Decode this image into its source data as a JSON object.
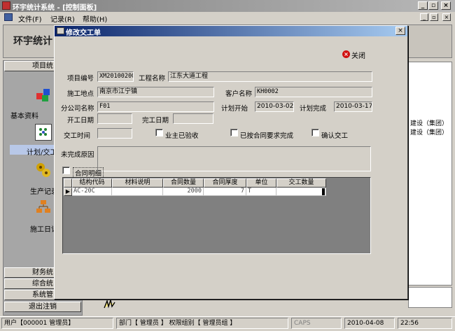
{
  "app": {
    "title": "环宇统计系统 - [控制面板]"
  },
  "menu": {
    "items": [
      "文件(F)",
      "记录(R)",
      "帮助(H)"
    ]
  },
  "backdrop": {
    "header_title": "环宇统计",
    "side_head": "项目统",
    "side_items": [
      "基本资料",
      "计划/交工",
      "生产记录",
      "施工日记"
    ],
    "side_bottom": [
      "财务统",
      "综合统",
      "系统管",
      "退出注销"
    ],
    "right_rows": [
      "建设（集团）",
      "建设（集团）"
    ]
  },
  "dialog": {
    "title": "修改交工单",
    "close_label": "关闭",
    "labels": {
      "project_no": "项目编号",
      "project_name": "工程名称",
      "site": "施工地点",
      "customer": "客户名称",
      "branch": "分公司名称",
      "plan_start": "计划开始",
      "plan_end": "计划完成",
      "start_date": "开工日期",
      "finish_date": "完工日期",
      "handover_time": "交工时间",
      "unfinished_reason": "未完成原因"
    },
    "values": {
      "project_no": "XM20100200",
      "project_name": "江东大道工程",
      "site": "南京市江宁镇",
      "customer": "KH0002",
      "branch": "F01",
      "plan_start": "2010-03-02",
      "plan_end": "2010-03-17",
      "start_date": "",
      "finish_date": "",
      "handover_time": ""
    },
    "checkboxes": {
      "owner_accepted": "业主已验收",
      "per_contract": "已按合同要求完成",
      "confirm_handover": "确认交工",
      "contract_detail": "合同明细"
    },
    "grid": {
      "columns": [
        "结构代码",
        "材料说明",
        "合同数量",
        "合同厚度",
        "单位",
        "交工数量"
      ],
      "rows": [
        [
          "AC-20C",
          "",
          "2000",
          "7",
          "T",
          ""
        ]
      ]
    }
  },
  "status": {
    "user": "用户【000001 管理员】",
    "dept": "部门【 管理员 】 权限组别【 管理员组 】",
    "caps": "CAPS",
    "date": "2010-04-08",
    "time": "22:56"
  }
}
